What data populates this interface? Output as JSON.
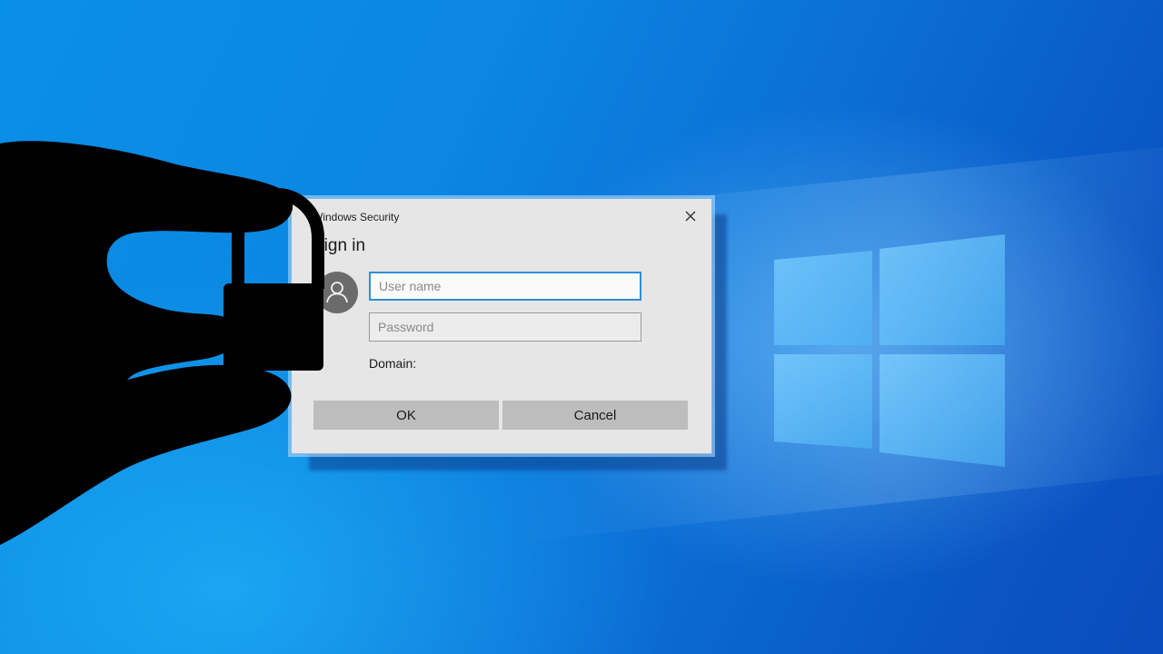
{
  "dialog": {
    "window_title": "Windows Security",
    "heading": "Sign in",
    "username_placeholder": "User name",
    "username_value": "",
    "password_placeholder": "Password",
    "password_value": "",
    "domain_label": "Domain:",
    "ok_label": "OK",
    "cancel_label": "Cancel",
    "close_icon": "close-icon",
    "avatar_icon": "user-avatar-icon"
  },
  "background": {
    "logo_icon": "windows-logo-icon",
    "accent_color": "#0a78d7"
  },
  "overlay": {
    "hand_icon": "hand-silhouette-icon",
    "lock_icon": "padlock-icon"
  }
}
